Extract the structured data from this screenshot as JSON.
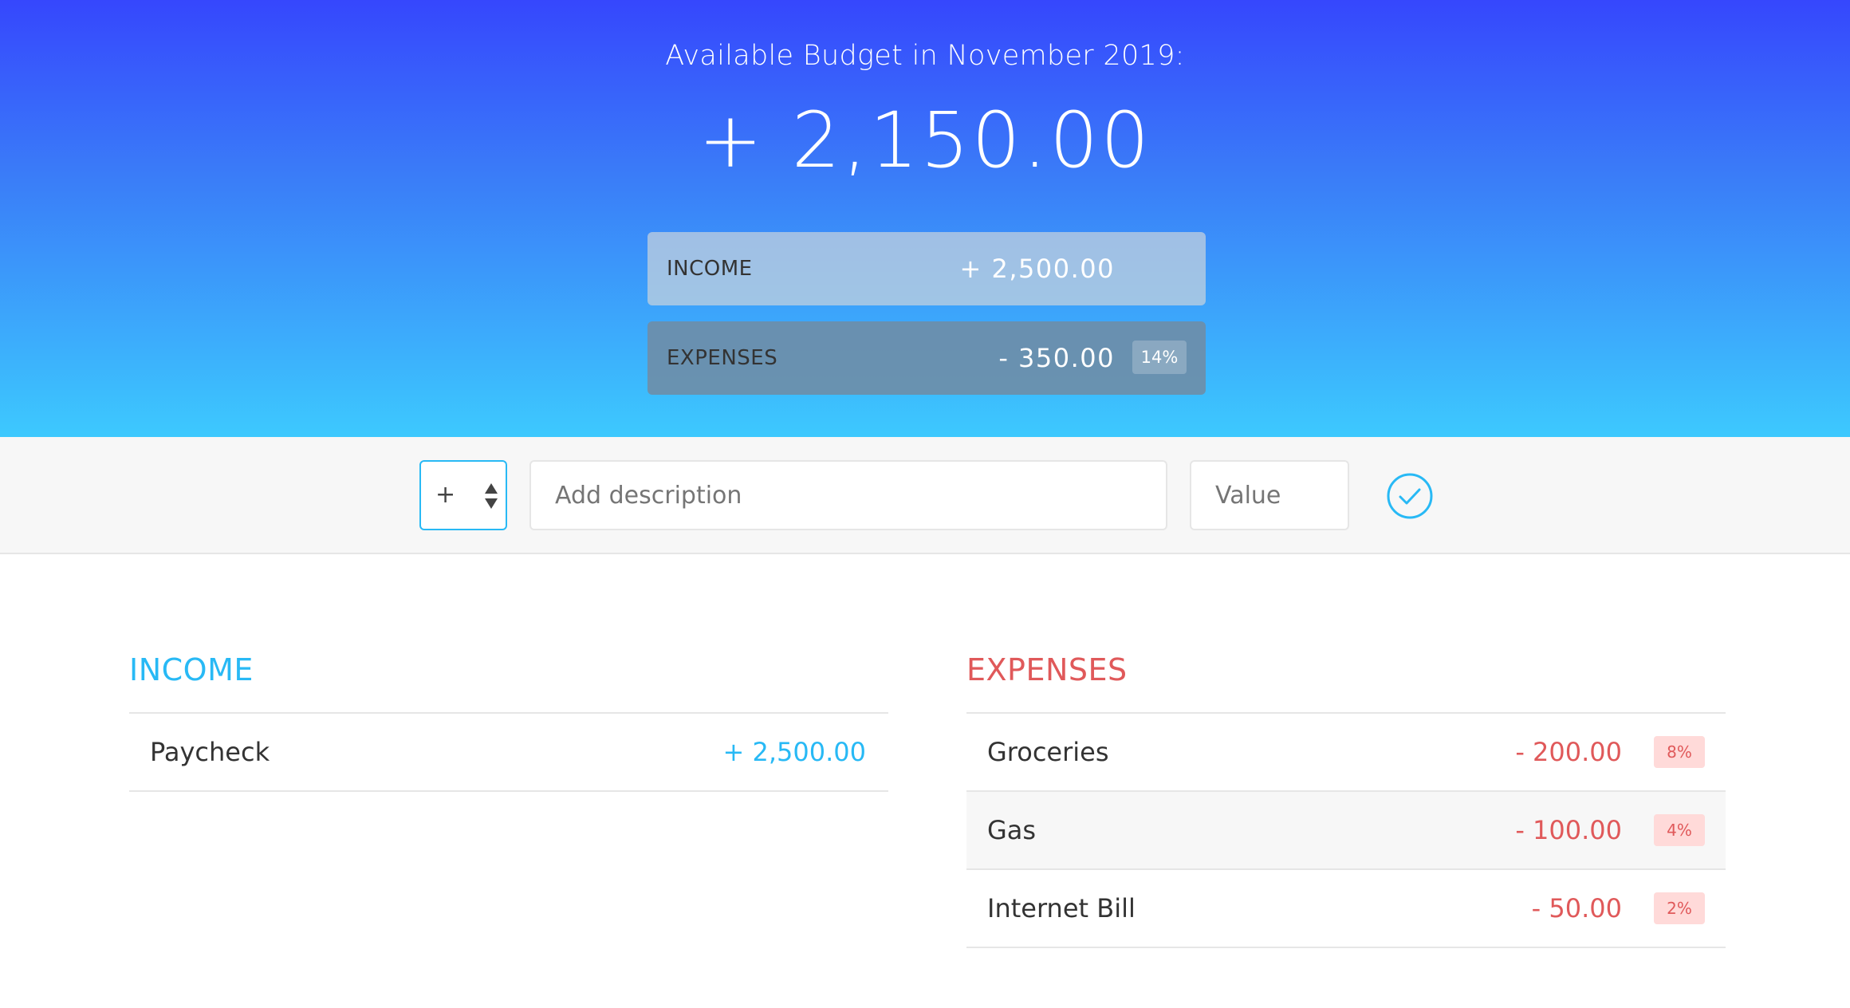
{
  "header": {
    "title": "Available Budget in November 2019:",
    "budget": "+ 2,150.00",
    "income": {
      "label": "INCOME",
      "value": "+ 2,500.00"
    },
    "expenses": {
      "label": "EXPENSES",
      "value": "- 350.00",
      "percentage": "14%"
    }
  },
  "add_bar": {
    "type_value": "+",
    "description_placeholder": "Add description",
    "value_placeholder": "Value",
    "submit_icon": "check-circle-icon"
  },
  "income_list": {
    "title": "INCOME",
    "items": [
      {
        "description": "Paycheck",
        "value": "+ 2,500.00"
      }
    ]
  },
  "expenses_list": {
    "title": "EXPENSES",
    "items": [
      {
        "description": "Groceries",
        "value": "- 200.00",
        "percentage": "8%"
      },
      {
        "description": "Gas",
        "value": "- 100.00",
        "percentage": "4%"
      },
      {
        "description": "Internet Bill",
        "value": "- 50.00",
        "percentage": "2%"
      }
    ]
  },
  "colors": {
    "income": "#28b9f5",
    "expenses": "#e0595a",
    "gradient_top": "#3647fd",
    "gradient_bottom": "#3dc9fe"
  }
}
